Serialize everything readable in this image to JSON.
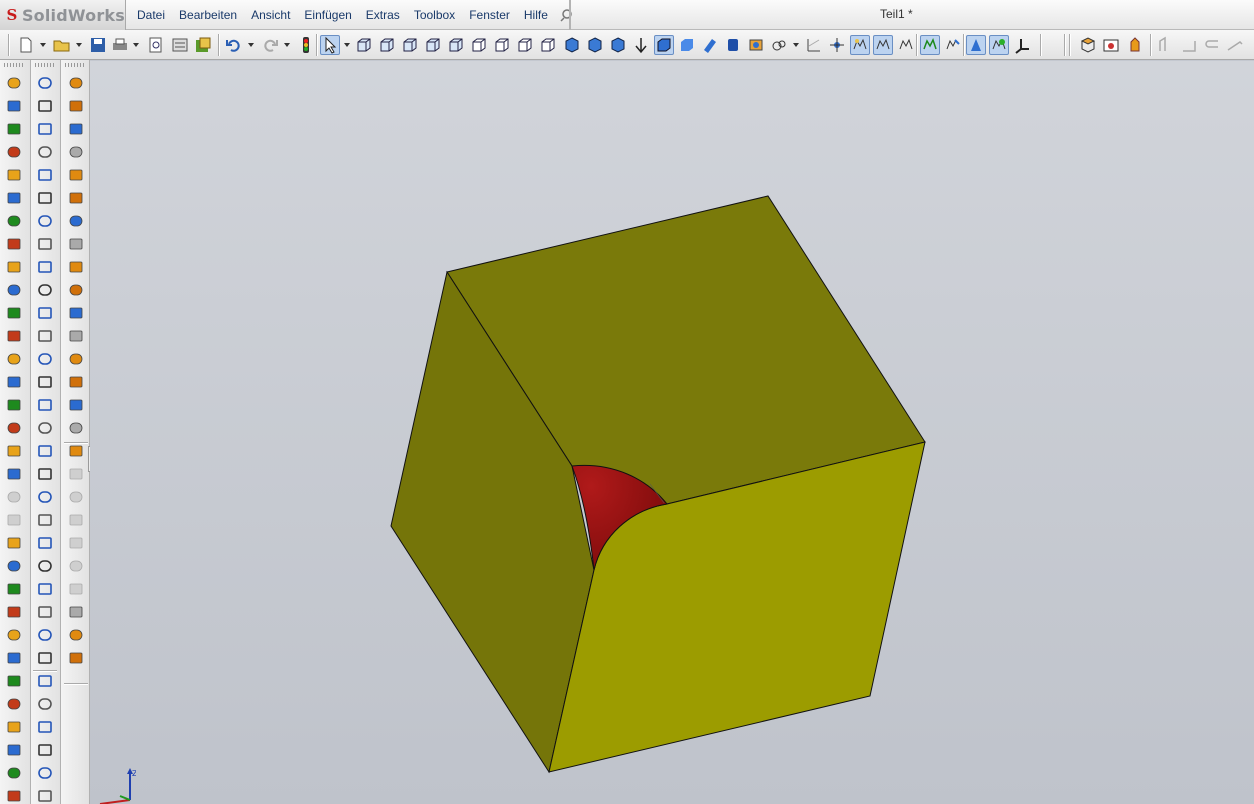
{
  "app": {
    "logo_text": "SolidWorks",
    "document_title": "Teil1 *"
  },
  "menu": {
    "items": [
      "Datei",
      "Bearbeiten",
      "Ansicht",
      "Einfügen",
      "Extras",
      "Toolbox",
      "Fenster",
      "Hilfe"
    ]
  },
  "toolbar": {
    "icons": [
      "new-document-icon",
      "open-folder-icon",
      "save-icon",
      "print-icon",
      "print-preview-icon",
      "options-icon",
      "rebuild-icon",
      "undo-icon",
      "redo-icon",
      "traffic-light-icon",
      "select-arrow-icon",
      "view-orientation-icon",
      "wireframe-icon",
      "hidden-lines-icon",
      "shaded-icon",
      "section-view-icon",
      "zoom-fit-icon",
      "rotate-icon",
      "pan-icon",
      "appearance-icon"
    ]
  },
  "colors": {
    "model_top": "#7a7a0a",
    "model_left": "#757509",
    "model_front": "#9c9c00",
    "fillet": "#8c0f0f",
    "viewport_bg": "#c4c8d0"
  }
}
